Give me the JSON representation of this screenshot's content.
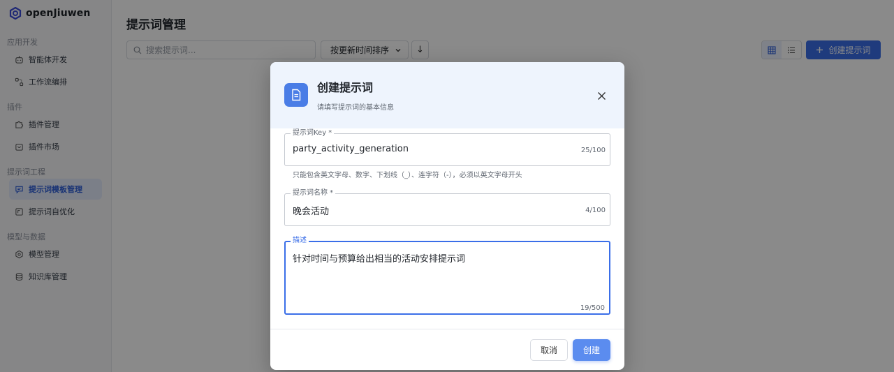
{
  "app": {
    "name": "openJiuwen"
  },
  "sidebar": {
    "groups": [
      {
        "title": "应用开发",
        "items": [
          {
            "label": "智能体开发",
            "icon": "robot-icon"
          },
          {
            "label": "工作流编排",
            "icon": "workflow-icon"
          }
        ]
      },
      {
        "title": "插件",
        "items": [
          {
            "label": "插件管理",
            "icon": "puzzle-icon"
          },
          {
            "label": "插件市场",
            "icon": "store-icon"
          }
        ]
      },
      {
        "title": "提示词工程",
        "items": [
          {
            "label": "提示词模板管理",
            "icon": "chat-template-icon",
            "active": true
          },
          {
            "label": "提示词自优化",
            "icon": "optimize-icon"
          }
        ]
      },
      {
        "title": "模型与数据",
        "items": [
          {
            "label": "模型管理",
            "icon": "model-icon"
          },
          {
            "label": "知识库管理",
            "icon": "database-icon"
          }
        ]
      }
    ]
  },
  "main": {
    "title": "提示词管理",
    "search_placeholder": "搜索提示词...",
    "sort_label": "按更新时间排序",
    "sort_direction_symbol": "↓",
    "create_label": "创建提示词"
  },
  "modal": {
    "title": "创建提示词",
    "subtitle": "请填写提示词的基本信息",
    "fields": {
      "key": {
        "label": "提示词Key *",
        "value": "party_activity_generation",
        "count": "25/100",
        "hint": "只能包含英文字母、数字、下划线（_）、连字符（-），必须以英文字母开头"
      },
      "name": {
        "label": "提示词名称 *",
        "value": "晚会活动",
        "count": "4/100"
      },
      "desc": {
        "label": "描述",
        "value": "针对时间与预算给出相当的活动安排提示词",
        "count": "19/500"
      }
    },
    "cancel_label": "取消",
    "submit_label": "创建"
  },
  "colors": {
    "primary": "#3a6ee8",
    "active_nav_bg": "#e3eafb",
    "modal_header_bg": "#eef4fd"
  }
}
